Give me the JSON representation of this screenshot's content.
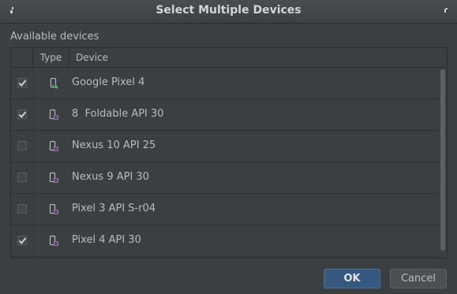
{
  "window": {
    "title": "Select Multiple Devices"
  },
  "section_label": "Available devices",
  "table": {
    "headers": {
      "select": "",
      "type": "Type",
      "device": "Device"
    },
    "rows": [
      {
        "checked": true,
        "icon": "phone-running-icon",
        "name": "Google Pixel 4"
      },
      {
        "checked": true,
        "icon": "virtual-device-icon",
        "name": "8  Foldable API 30"
      },
      {
        "checked": false,
        "icon": "virtual-device-icon",
        "name": "Nexus 10 API 25"
      },
      {
        "checked": false,
        "icon": "virtual-device-icon",
        "name": "Nexus 9 API 30"
      },
      {
        "checked": false,
        "icon": "virtual-device-icon",
        "name": "Pixel 3 API S-r04"
      },
      {
        "checked": true,
        "icon": "virtual-device-icon",
        "name": "Pixel 4 API 30"
      }
    ]
  },
  "buttons": {
    "ok": "OK",
    "cancel": "Cancel"
  },
  "colors": {
    "background": "#3c3f41",
    "ok_button": "#365880",
    "running_indicator": "#4caf50",
    "virtual_device_accent": "#9876aa"
  }
}
